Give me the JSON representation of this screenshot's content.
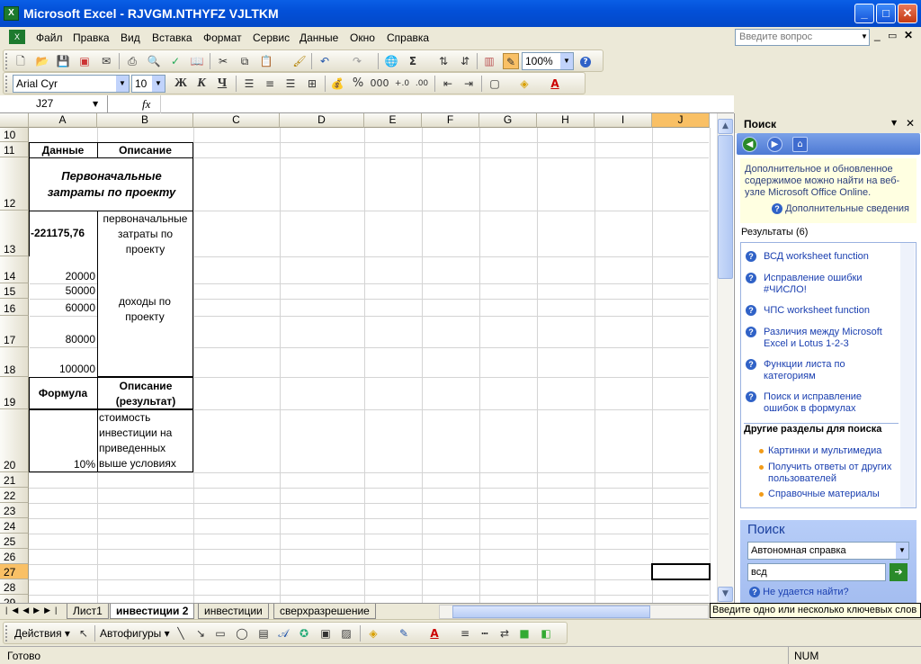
{
  "window": {
    "title": "Microsoft Excel - RJVGM.NTHYFZ VJLTKM"
  },
  "menu": {
    "items": [
      "Файл",
      "Правка",
      "Вид",
      "Вставка",
      "Формат",
      "Сервис",
      "Данные",
      "Окно",
      "Справка"
    ],
    "help_placeholder": "Введите вопрос"
  },
  "toolbar": {
    "zoom": "100%"
  },
  "format_toolbar": {
    "font": "Arial Cyr",
    "size": "10",
    "bold": "Ж",
    "italic": "К",
    "underline": "Ч",
    "percent": "%",
    "thousands": "000"
  },
  "formula_bar": {
    "name_box": "J27",
    "fx": "fx"
  },
  "columns": [
    "A",
    "B",
    "C",
    "D",
    "E",
    "F",
    "G",
    "H",
    "I",
    "J"
  ],
  "rows": [
    "10",
    "11",
    "12",
    "13",
    "14",
    "15",
    "16",
    "17",
    "18",
    "19",
    "20",
    "21",
    "22",
    "23",
    "24",
    "25",
    "26",
    "27",
    "28",
    "29"
  ],
  "cells": {
    "a11": "Данные",
    "b11": "Описание",
    "a12": "Первоначальные затраты по проекту",
    "a13": "-221175,76",
    "b13": "первоначальные затраты по проекту",
    "a14": "20000",
    "a15": "50000",
    "a16": "60000",
    "a17": "80000",
    "a18": "100000",
    "b14_18": "доходы по проекту",
    "a19": "Формула",
    "b19": "Описание (результат)",
    "a20": "10%",
    "b20": "стоимость инвестиции на приведенных выше условиях"
  },
  "sheet_tabs": [
    "Лист1",
    "инвестиции 2",
    "инвестиции",
    "сверхразрешение"
  ],
  "active_tab": "инвестиции 2",
  "task_pane": {
    "title": "Поиск",
    "info": "Дополнительное и обновленное содержимое можно найти на веб-узле Microsoft Office Online.",
    "more_info": "Дополнительные сведения",
    "results_label": "Результаты (6)",
    "results": [
      "ВСД worksheet function",
      "Исправление ошибки #ЧИСЛО!",
      "ЧПС worksheet function",
      "Различия между Microsoft Excel и Lotus 1-2-3",
      "Функции листа по категориям",
      "Поиск и исправление ошибок в формулах"
    ],
    "other_title": "Другие разделы для поиска",
    "other": [
      "Картинки и мультимедиа",
      "Получить ответы от других пользователей",
      "Справочные материалы"
    ],
    "search_title": "Поиск",
    "scope": "Автономная справка",
    "query": "всд",
    "cant_find": "Не удается найти?",
    "tooltip": "Введите одно или несколько ключевых слов"
  },
  "draw_toolbar": {
    "actions": "Действия",
    "autoshapes": "Автофигуры"
  },
  "status": {
    "ready": "Готово",
    "num": "NUM"
  }
}
